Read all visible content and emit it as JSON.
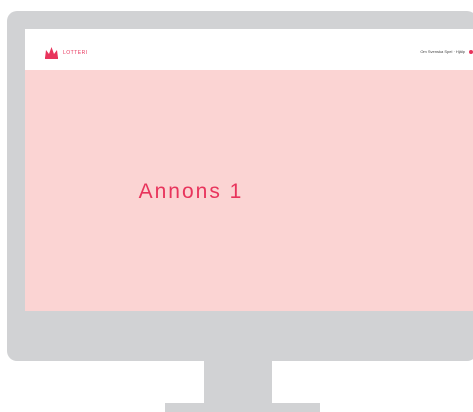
{
  "header": {
    "logo_text": "LOTTERI",
    "nav_text": "Om Svenska Spel · Hjälp"
  },
  "main": {
    "ad_label": "Annons 1"
  },
  "colors": {
    "accent": "#e8345c",
    "screen_bg": "#fbd4d3",
    "monitor": "#d1d2d4"
  }
}
